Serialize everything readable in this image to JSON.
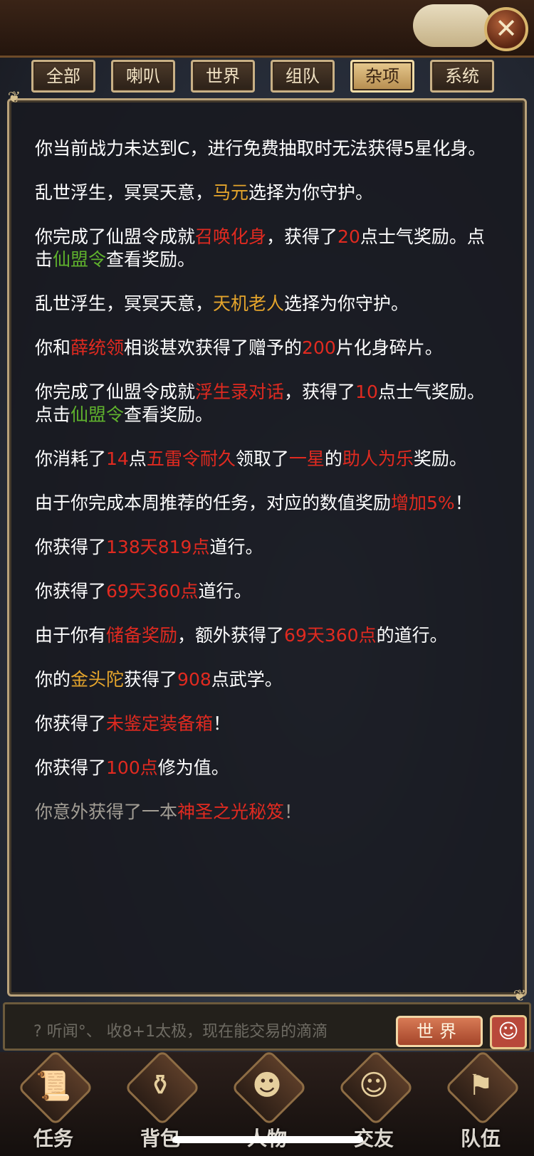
{
  "header": {
    "close_icon": "close-icon"
  },
  "tabs": [
    {
      "label": "全部",
      "active": false
    },
    {
      "label": "喇叭",
      "active": false
    },
    {
      "label": "世界",
      "active": false
    },
    {
      "label": "组队",
      "active": false
    },
    {
      "label": "杂项",
      "active": true
    },
    {
      "label": "系统",
      "active": false
    }
  ],
  "messages": [
    {
      "dim": false,
      "parts": [
        {
          "t": "你当前战力未达到C，进行免费抽取时无法获得5星化身。",
          "c": ""
        }
      ]
    },
    {
      "dim": false,
      "parts": [
        {
          "t": "乱世浮生，冥冥天意，",
          "c": ""
        },
        {
          "t": "马元",
          "c": "gold"
        },
        {
          "t": "选择为你守护。",
          "c": ""
        }
      ]
    },
    {
      "dim": false,
      "parts": [
        {
          "t": "你完成了仙盟令成就",
          "c": ""
        },
        {
          "t": "召唤化身",
          "c": "red"
        },
        {
          "t": "，获得了",
          "c": ""
        },
        {
          "t": "20",
          "c": "red"
        },
        {
          "t": "点士气奖励。点击",
          "c": ""
        },
        {
          "t": "仙盟令",
          "c": "green"
        },
        {
          "t": "查看奖励。",
          "c": ""
        }
      ]
    },
    {
      "dim": false,
      "parts": [
        {
          "t": "乱世浮生，冥冥天意，",
          "c": ""
        },
        {
          "t": "天机老人",
          "c": "gold"
        },
        {
          "t": "选择为你守护。",
          "c": ""
        }
      ]
    },
    {
      "dim": false,
      "parts": [
        {
          "t": "你和",
          "c": ""
        },
        {
          "t": "薛统领",
          "c": "red"
        },
        {
          "t": "相谈甚欢获得了赠予的",
          "c": ""
        },
        {
          "t": "200",
          "c": "red"
        },
        {
          "t": "片化身碎片。",
          "c": ""
        }
      ]
    },
    {
      "dim": false,
      "parts": [
        {
          "t": "你完成了仙盟令成就",
          "c": ""
        },
        {
          "t": "浮生录对话",
          "c": "red"
        },
        {
          "t": "，获得了",
          "c": ""
        },
        {
          "t": "10",
          "c": "red"
        },
        {
          "t": "点士气奖励。点击",
          "c": ""
        },
        {
          "t": "仙盟令",
          "c": "green"
        },
        {
          "t": "查看奖励。",
          "c": ""
        }
      ]
    },
    {
      "dim": false,
      "parts": [
        {
          "t": "你消耗了",
          "c": ""
        },
        {
          "t": "14",
          "c": "red"
        },
        {
          "t": "点",
          "c": ""
        },
        {
          "t": "五雷令耐久",
          "c": "red"
        },
        {
          "t": "领取了",
          "c": ""
        },
        {
          "t": "一星",
          "c": "red"
        },
        {
          "t": "的",
          "c": ""
        },
        {
          "t": "助人为乐",
          "c": "red"
        },
        {
          "t": "奖励。",
          "c": ""
        }
      ]
    },
    {
      "dim": false,
      "parts": [
        {
          "t": "由于你完成本周推荐的任务，对应的数值奖励",
          "c": ""
        },
        {
          "t": "增加5%",
          "c": "red"
        },
        {
          "t": "！",
          "c": ""
        }
      ]
    },
    {
      "dim": false,
      "parts": [
        {
          "t": "你获得了",
          "c": ""
        },
        {
          "t": "138天819点",
          "c": "red"
        },
        {
          "t": "道行。",
          "c": ""
        }
      ]
    },
    {
      "dim": false,
      "parts": [
        {
          "t": "你获得了",
          "c": ""
        },
        {
          "t": "69天360点",
          "c": "red"
        },
        {
          "t": "道行。",
          "c": ""
        }
      ]
    },
    {
      "dim": false,
      "parts": [
        {
          "t": "由于你有",
          "c": ""
        },
        {
          "t": "储备奖励",
          "c": "red"
        },
        {
          "t": "，额外获得了",
          "c": ""
        },
        {
          "t": "69天360点",
          "c": "red"
        },
        {
          "t": "的道行。",
          "c": ""
        }
      ]
    },
    {
      "dim": false,
      "parts": [
        {
          "t": "你的",
          "c": ""
        },
        {
          "t": "金头陀",
          "c": "gold"
        },
        {
          "t": "获得了",
          "c": ""
        },
        {
          "t": "908",
          "c": "red"
        },
        {
          "t": "点武学。",
          "c": ""
        }
      ]
    },
    {
      "dim": false,
      "parts": [
        {
          "t": "你获得了",
          "c": ""
        },
        {
          "t": "未鉴定装备箱",
          "c": "red"
        },
        {
          "t": "！",
          "c": ""
        }
      ]
    },
    {
      "dim": false,
      "parts": [
        {
          "t": "你获得了",
          "c": ""
        },
        {
          "t": "100点",
          "c": "red"
        },
        {
          "t": "修为值。",
          "c": ""
        }
      ]
    },
    {
      "dim": true,
      "parts": [
        {
          "t": "你意外获得了一本",
          "c": ""
        },
        {
          "t": "神圣之光秘笈",
          "c": "red"
        },
        {
          "t": "！",
          "c": ""
        }
      ]
    }
  ],
  "chat": {
    "ticker": "听闻°、 收8+1太极，现在能交易的滴滴",
    "world_button": "世界"
  },
  "nav": [
    {
      "label": "任务",
      "icon": "scroll-icon"
    },
    {
      "label": "背包",
      "icon": "chest-icon"
    },
    {
      "label": "人物",
      "icon": "character-icon"
    },
    {
      "label": "交友",
      "icon": "friends-icon"
    },
    {
      "label": "队伍",
      "icon": "team-icon"
    }
  ]
}
